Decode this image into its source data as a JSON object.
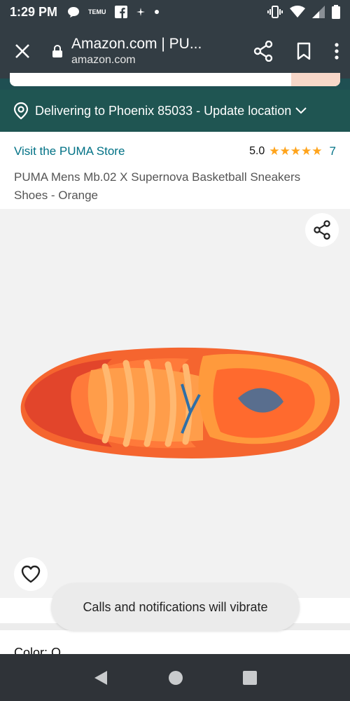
{
  "status_bar": {
    "time": "1:29 PM",
    "temu_label": "TEMU"
  },
  "browser": {
    "page_title": "Amazon.com | PU...",
    "domain": "amazon.com"
  },
  "delivery": {
    "text": "Delivering to Phoenix 85033 - Update location"
  },
  "product": {
    "store_link": "Visit the PUMA Store",
    "rating_value": "5.0",
    "stars": "★★★★★",
    "rating_count": "7",
    "title": "PUMA Mens Mb.02 X Supernova Basketball Sneakers Shoes - Orange"
  },
  "below": {
    "partial_text": "Color: O"
  },
  "toast": {
    "message": "Calls and notifications will vibrate"
  },
  "colors": {
    "header_bg": "#333d44",
    "delivery_bg": "#1f5552",
    "link": "#007185",
    "star": "#ffa41c",
    "shoe_orange": "#ff8a3d",
    "shoe_red": "#e2452b"
  },
  "icons": {
    "close": "close-icon",
    "lock": "lock-icon",
    "share": "share-icon",
    "bookmark": "bookmark-icon",
    "menu": "more-vert-icon",
    "location": "location-pin-icon",
    "heart": "heart-icon",
    "back": "back-triangle-icon",
    "home": "home-circle-icon",
    "recents": "recents-square-icon"
  }
}
